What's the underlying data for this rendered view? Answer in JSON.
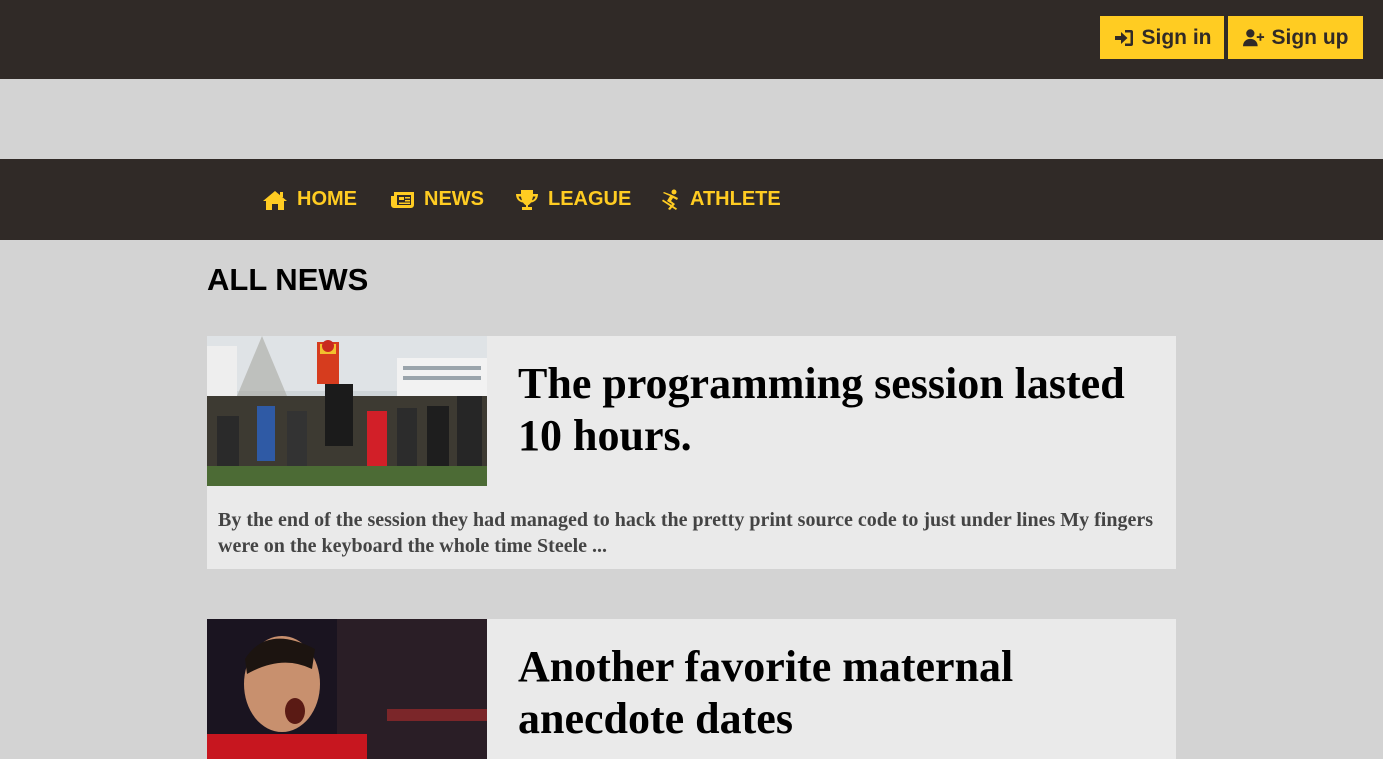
{
  "header": {
    "sign_in_label": "Sign in",
    "sign_up_label": "Sign up"
  },
  "nav": {
    "items": [
      {
        "label": "HOME",
        "icon": "home-icon"
      },
      {
        "label": "NEWS",
        "icon": "newspaper-icon"
      },
      {
        "label": "LEAGUE",
        "icon": "trophy-icon"
      },
      {
        "label": "ATHLETE",
        "icon": "athlete-icon"
      }
    ]
  },
  "main": {
    "section_title": "ALL NEWS",
    "articles": [
      {
        "title": "The programming session lasted 10 hours.",
        "excerpt": "By the end of the session they had managed to hack the pretty print source code to just under lines My fingers were on the keyboard the whole time Steele ..."
      },
      {
        "title": "Another favorite maternal anecdote dates",
        "excerpt": ""
      }
    ]
  },
  "colors": {
    "dark": "#302a27",
    "accent": "#ffcc22",
    "background": "#d3d3d3",
    "card": "#eaeaea"
  }
}
